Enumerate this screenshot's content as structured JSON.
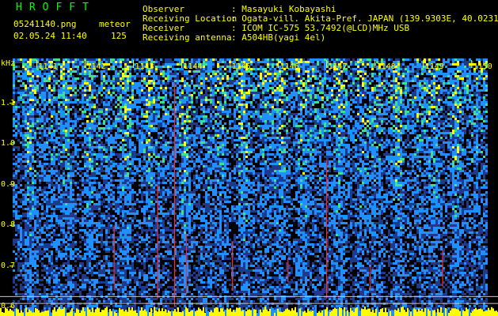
{
  "header": {
    "logo": "HROFFT",
    "filename": "05241140.png",
    "datetime": "02.05.24 11:40",
    "category": "meteor",
    "count": "125",
    "info": [
      {
        "label": "Observer",
        "value": ": Masayuki Kobayashi"
      },
      {
        "label": "Receiving Location",
        "value": ": Ogata-vill. Akita-Pref. JAPAN (139.9303E, 40.0231N)"
      },
      {
        "label": "Receiver",
        "value": ": ICOM IC-575 53.7492(@LCD)MHz USB"
      },
      {
        "label": "Receiving antenna",
        "value": ": A504HB(yagi 4el)"
      }
    ]
  },
  "chart_data": {
    "type": "heatmap",
    "ylabel": "kHz",
    "y_ticks": [
      "1.1",
      "1.0",
      "0.9",
      "0.8",
      "0.7",
      "0.6"
    ],
    "y_tick_values": [
      1.1,
      1.0,
      0.9,
      0.8,
      0.7,
      0.6
    ],
    "ylim": [
      0.585,
      1.21
    ],
    "x_ticks": [
      "1141",
      "1142",
      "1143",
      "1144",
      "1145",
      "1146",
      "1147",
      "1148",
      "1149",
      "1150"
    ],
    "x_tick_values": [
      1141,
      1142,
      1143,
      1144,
      1145,
      1146,
      1147,
      1148,
      1149,
      1150
    ],
    "xlim": [
      1140.5,
      1150.3
    ],
    "colors": {
      "background": "#000000",
      "low": "#1f3a8a",
      "mid": "#1e90ff",
      "high": "#3fe08f",
      "peak": "#ffff00",
      "meteor": "#ff2a2a",
      "reference_line": "#c8c8c8"
    }
  }
}
